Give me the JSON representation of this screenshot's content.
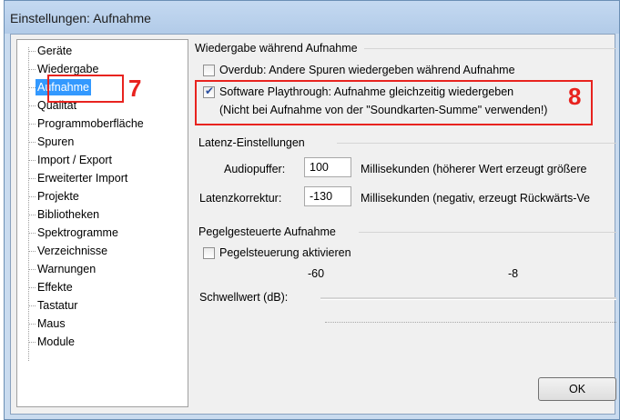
{
  "window": {
    "title": "Einstellungen: Aufnahme"
  },
  "tree": {
    "items": [
      {
        "label": "Geräte"
      },
      {
        "label": "Wiedergabe"
      },
      {
        "label": "Aufnahme"
      },
      {
        "label": "Qualität"
      },
      {
        "label": "Programmoberfläche"
      },
      {
        "label": "Spuren"
      },
      {
        "label": "Import / Export"
      },
      {
        "label": "Erweiterter Import"
      },
      {
        "label": "Projekte"
      },
      {
        "label": "Bibliotheken"
      },
      {
        "label": "Spektrogramme"
      },
      {
        "label": "Verzeichnisse"
      },
      {
        "label": "Warnungen"
      },
      {
        "label": "Effekte"
      },
      {
        "label": "Tastatur"
      },
      {
        "label": "Maus"
      },
      {
        "label": "Module"
      }
    ],
    "selected": "Aufnahme"
  },
  "annotations": {
    "label7": "7",
    "label8": "8"
  },
  "playback": {
    "title": "Wiedergabe während Aufnahme",
    "overdub_label": "Overdub: Andere Spuren wiedergeben während Aufnahme",
    "overdub_checked": false,
    "playthrough_label": "Software Playthrough: Aufnahme gleichzeitig wiedergeben",
    "playthrough_checked": true,
    "playthrough_note": "(Nicht bei Aufnahme von der \"Soundkarten-Summe\" verwenden!)"
  },
  "latency": {
    "title": "Latenz-Einstellungen",
    "buffer_label": "Audiopuffer:",
    "buffer_value": "100",
    "buffer_hint": "Millisekunden (höherer Wert erzeugt größere",
    "correction_label": "Latenzkorrektur:",
    "correction_value": "-130",
    "correction_hint": "Millisekunden (negativ, erzeugt Rückwärts-Ve"
  },
  "level": {
    "title": "Pegelgesteuerte Aufnahme",
    "activate_label": "Pegelsteuerung aktivieren",
    "activate_checked": false,
    "min": "-60",
    "max": "-8",
    "threshold_label": "Schwellwert (dB):"
  },
  "buttons": {
    "ok": "OK"
  }
}
